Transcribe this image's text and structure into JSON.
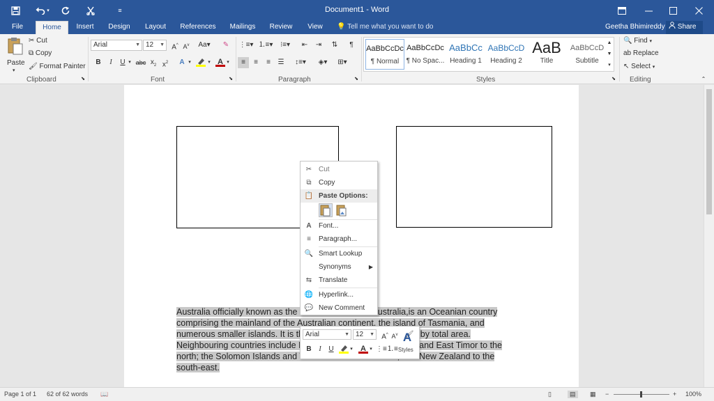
{
  "titlebar": {
    "document_title": "Document1 - Word",
    "save_icon": "save-icon",
    "undo_icon": "undo-icon",
    "redo_icon": "redo-icon",
    "format_painter_icon": "format-painter-icon",
    "customize_icon": "customize-quick-access-icon",
    "window_controls": [
      "ribbon-display-icon",
      "minimize-icon",
      "maximize-icon",
      "close-icon"
    ]
  },
  "tabs": [
    {
      "label": "File"
    },
    {
      "label": "Home"
    },
    {
      "label": "Insert"
    },
    {
      "label": "Design"
    },
    {
      "label": "Layout"
    },
    {
      "label": "References"
    },
    {
      "label": "Mailings"
    },
    {
      "label": "Review"
    },
    {
      "label": "View"
    }
  ],
  "tellme": "Tell me what you want to do",
  "user": "Geetha Bhimireddy",
  "share": "Share",
  "ribbon": {
    "clipboard": {
      "paste": "Paste",
      "cut": "Cut",
      "copy": "Copy",
      "format_painter": "Format Painter",
      "label": "Clipboard"
    },
    "font": {
      "font_name": "Arial",
      "font_size": "12",
      "label": "Font"
    },
    "paragraph": {
      "label": "Paragraph"
    },
    "styles": {
      "label": "Styles",
      "items": [
        {
          "preview": "AaBbCcDc",
          "name": "¶ Normal"
        },
        {
          "preview": "AaBbCcDc",
          "name": "¶ No Spac..."
        },
        {
          "preview": "AaBbCc",
          "name": "Heading 1"
        },
        {
          "preview": "AaBbCcD",
          "name": "Heading 2"
        },
        {
          "preview": "AaB",
          "name": "Title"
        },
        {
          "preview": "AaBbCcD",
          "name": "Subtitle"
        }
      ]
    },
    "editing": {
      "find": "Find",
      "replace": "Replace",
      "select": "Select",
      "label": "Editing"
    }
  },
  "document": {
    "paragraph_lines": [
      "Australia officially known as the Commonwealth of Australia,is an Oceanian country",
      "comprising the mainland of the Australian continent, the island of Tasmania, and",
      "numerous smaller islands. It is the world's sixth-largest country by total area.",
      "Neighbouring countries include Papua New Guinea, Indonesia and East Timor to the",
      "north; the Solomon Islands and Vanuatu to the north-east; and New Zealand to the",
      "south-east."
    ]
  },
  "context_menu": {
    "cut": "Cut",
    "copy": "Copy",
    "paste_options": "Paste Options:",
    "font": "Font...",
    "paragraph": "Paragraph...",
    "smart_lookup": "Smart Lookup",
    "synonyms": "Synonyms",
    "translate": "Translate",
    "hyperlink": "Hyperlink...",
    "new_comment": "New Comment"
  },
  "mini_toolbar": {
    "font_name": "Arial",
    "font_size": "12",
    "styles": "Styles"
  },
  "status": {
    "page": "Page 1 of 1",
    "words": "62 of 62 words",
    "zoom": "100%"
  },
  "colors": {
    "accent": "#2b579a",
    "highlight": "#ffff00",
    "font_color": "#c00000"
  }
}
